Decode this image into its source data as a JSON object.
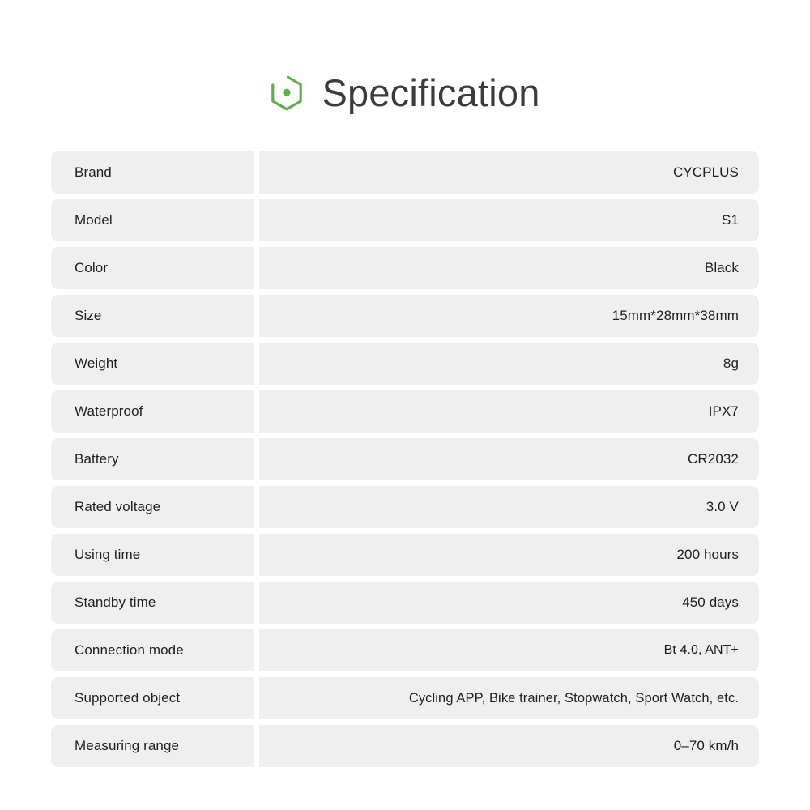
{
  "header": {
    "title": "Specification",
    "logo_icon": "hexagon-dot-icon",
    "logo_color": "#5fb14b"
  },
  "theme": {
    "page_background": "#ffffff",
    "cell_background": "#efefef",
    "text_color": "#1f1f1f",
    "title_color": "#3b3b3b",
    "accent": "#5fb14b"
  },
  "spec_table": {
    "rows": [
      {
        "label": "Brand",
        "value": "CYCPLUS"
      },
      {
        "label": "Model",
        "value": "S1"
      },
      {
        "label": "Color",
        "value": "Black"
      },
      {
        "label": "Size",
        "value": "15mm*28mm*38mm"
      },
      {
        "label": "Weight",
        "value": "8g"
      },
      {
        "label": "Waterproof",
        "value": "IPX7"
      },
      {
        "label": "Battery",
        "value": "CR2032"
      },
      {
        "label": "Rated voltage",
        "value": "3.0 V"
      },
      {
        "label": "Using time",
        "value": "200 hours"
      },
      {
        "label": "Standby time",
        "value": "450 days"
      },
      {
        "label": "Connection mode",
        "value": "Bt 4.0, ANT+"
      },
      {
        "label": "Supported object",
        "value": "Cycling APP, Bike trainer, Stopwatch, Sport Watch, etc."
      },
      {
        "label": "Measuring range",
        "value": "0–70 km/h"
      }
    ]
  }
}
